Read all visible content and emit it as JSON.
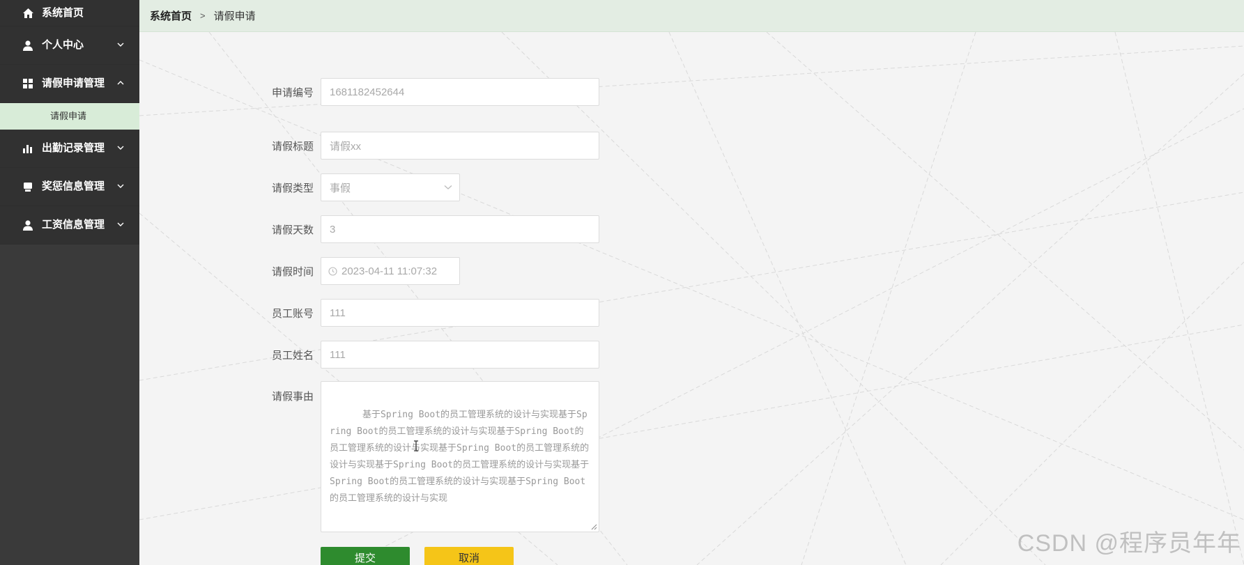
{
  "sidebar": {
    "items": [
      {
        "label": "系统首页",
        "icon": "home-icon"
      },
      {
        "label": "个人中心",
        "icon": "user-icon"
      },
      {
        "label": "请假申请管理",
        "icon": "grid-icon",
        "expanded": true,
        "children": [
          {
            "label": "请假申请"
          }
        ]
      },
      {
        "label": "出勤记录管理",
        "icon": "bar-chart-icon"
      },
      {
        "label": "奖惩信息管理",
        "icon": "award-icon"
      },
      {
        "label": "工资信息管理",
        "icon": "user-icon"
      }
    ]
  },
  "breadcrumb": {
    "home": "系统首页",
    "separator": ">",
    "current": "请假申请"
  },
  "form": {
    "application_no": {
      "label": "申请编号",
      "value": "1681182452644"
    },
    "title": {
      "label": "请假标题",
      "value": "请假xx"
    },
    "type": {
      "label": "请假类型",
      "value": "事假"
    },
    "days": {
      "label": "请假天数",
      "value": "3"
    },
    "time": {
      "label": "请假时间",
      "value": "2023-04-11 11:07:32"
    },
    "employee_account": {
      "label": "员工账号",
      "value": "111"
    },
    "employee_name": {
      "label": "员工姓名",
      "value": "111"
    },
    "reason": {
      "label": "请假事由",
      "value": "基于Spring Boot的员工管理系统的设计与实现基于Spring Boot的员工管理系统的设计与实现基于Spring Boot的员工管理系统的设计与实现基于Spring Boot的员工管理系统的设计与实现基于Spring Boot的员工管理系统的设计与实现基于Spring Boot的员工管理系统的设计与实现基于Spring Boot的员工管理系统的设计与实现"
    },
    "submit_label": "提交",
    "cancel_label": "取消"
  },
  "watermark": "CSDN @程序员年年",
  "colors": {
    "sidebar_bg": "#3a3a3a",
    "active_sub_bg": "#d8ecd8",
    "submit": "#2e8b2e",
    "cancel": "#f5c518"
  }
}
